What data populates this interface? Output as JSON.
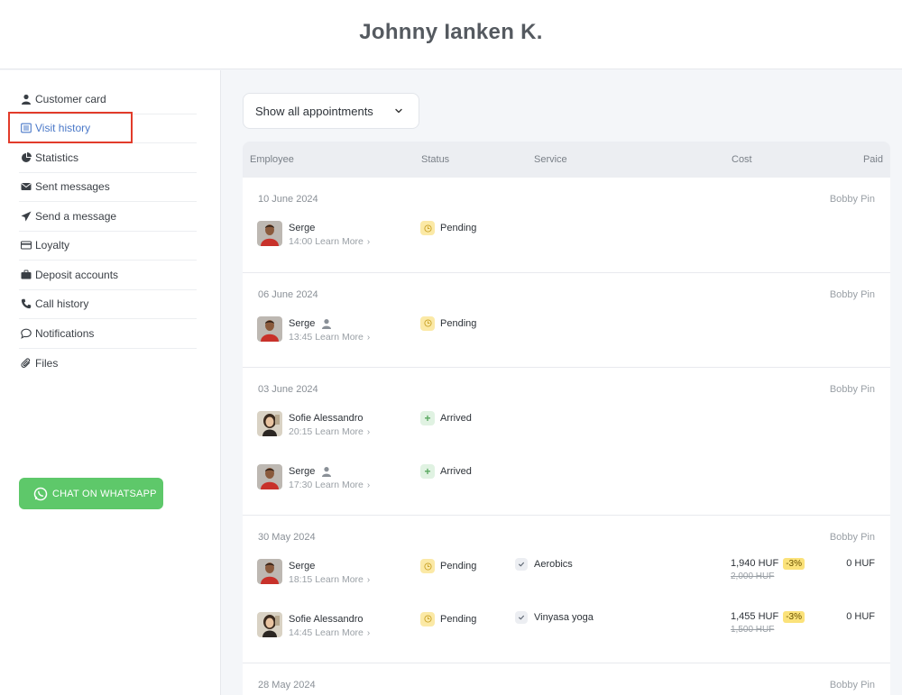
{
  "header": {
    "title": "Johnny Ianken K."
  },
  "sidebar": {
    "items": [
      {
        "label": "Customer card",
        "icon": "user-icon",
        "active": false
      },
      {
        "label": "Visit history",
        "icon": "list-icon",
        "active": true
      },
      {
        "label": "Statistics",
        "icon": "pie-chart-icon",
        "active": false
      },
      {
        "label": "Sent messages",
        "icon": "envelope-icon",
        "active": false
      },
      {
        "label": "Send a message",
        "icon": "paper-plane-icon",
        "active": false
      },
      {
        "label": "Loyalty",
        "icon": "card-icon",
        "active": false
      },
      {
        "label": "Deposit accounts",
        "icon": "briefcase-icon",
        "active": false
      },
      {
        "label": "Call history",
        "icon": "phone-icon",
        "active": false
      },
      {
        "label": "Notifications",
        "icon": "chat-bubble-icon",
        "active": false
      },
      {
        "label": "Files",
        "icon": "paperclip-icon",
        "active": false
      }
    ],
    "whatsapp_label": "CHAT ON WHATSAPP",
    "whatsapp_color": "#5ec86a"
  },
  "filter": {
    "selected": "Show all appointments"
  },
  "table": {
    "columns": {
      "employee": "Employee",
      "status": "Status",
      "service": "Service",
      "cost": "Cost",
      "paid": "Paid"
    },
    "groups": [
      {
        "date": "10 June 2024",
        "location": "Bobby Pin",
        "appointments": [
          {
            "employee": "Serge",
            "avatar": "serge",
            "person_icon": false,
            "time": "14:00",
            "more": "Learn More",
            "status": "Pending",
            "status_type": "pending"
          }
        ]
      },
      {
        "date": "06 June 2024",
        "location": "Bobby Pin",
        "appointments": [
          {
            "employee": "Serge",
            "avatar": "serge",
            "person_icon": true,
            "time": "13:45",
            "more": "Learn More",
            "status": "Pending",
            "status_type": "pending"
          }
        ]
      },
      {
        "date": "03 June 2024",
        "location": "Bobby Pin",
        "appointments": [
          {
            "employee": "Sofie Alessandro",
            "avatar": "sofie",
            "person_icon": false,
            "time": "20:15",
            "more": "Learn More",
            "status": "Arrived",
            "status_type": "arrived"
          },
          {
            "employee": "Serge",
            "avatar": "serge",
            "person_icon": true,
            "time": "17:30",
            "more": "Learn More",
            "status": "Arrived",
            "status_type": "arrived"
          }
        ]
      },
      {
        "date": "30 May 2024",
        "location": "Bobby Pin",
        "appointments": [
          {
            "employee": "Serge",
            "avatar": "serge",
            "person_icon": false,
            "time": "18:15",
            "more": "Learn More",
            "status": "Pending",
            "status_type": "pending",
            "service": "Aerobics",
            "cost": "1,940 HUF",
            "discount": "-3%",
            "original_cost": "2,000 HUF",
            "paid": "0 HUF"
          },
          {
            "employee": "Sofie Alessandro",
            "avatar": "sofie",
            "person_icon": false,
            "time": "14:45",
            "more": "Learn More",
            "status": "Pending",
            "status_type": "pending",
            "service": "Vinyasa yoga",
            "cost": "1,455 HUF",
            "discount": "-3%",
            "original_cost": "1,500 HUF",
            "paid": "0 HUF"
          }
        ]
      },
      {
        "date": "28 May 2024",
        "location": "Bobby Pin",
        "appointments": []
      }
    ]
  }
}
